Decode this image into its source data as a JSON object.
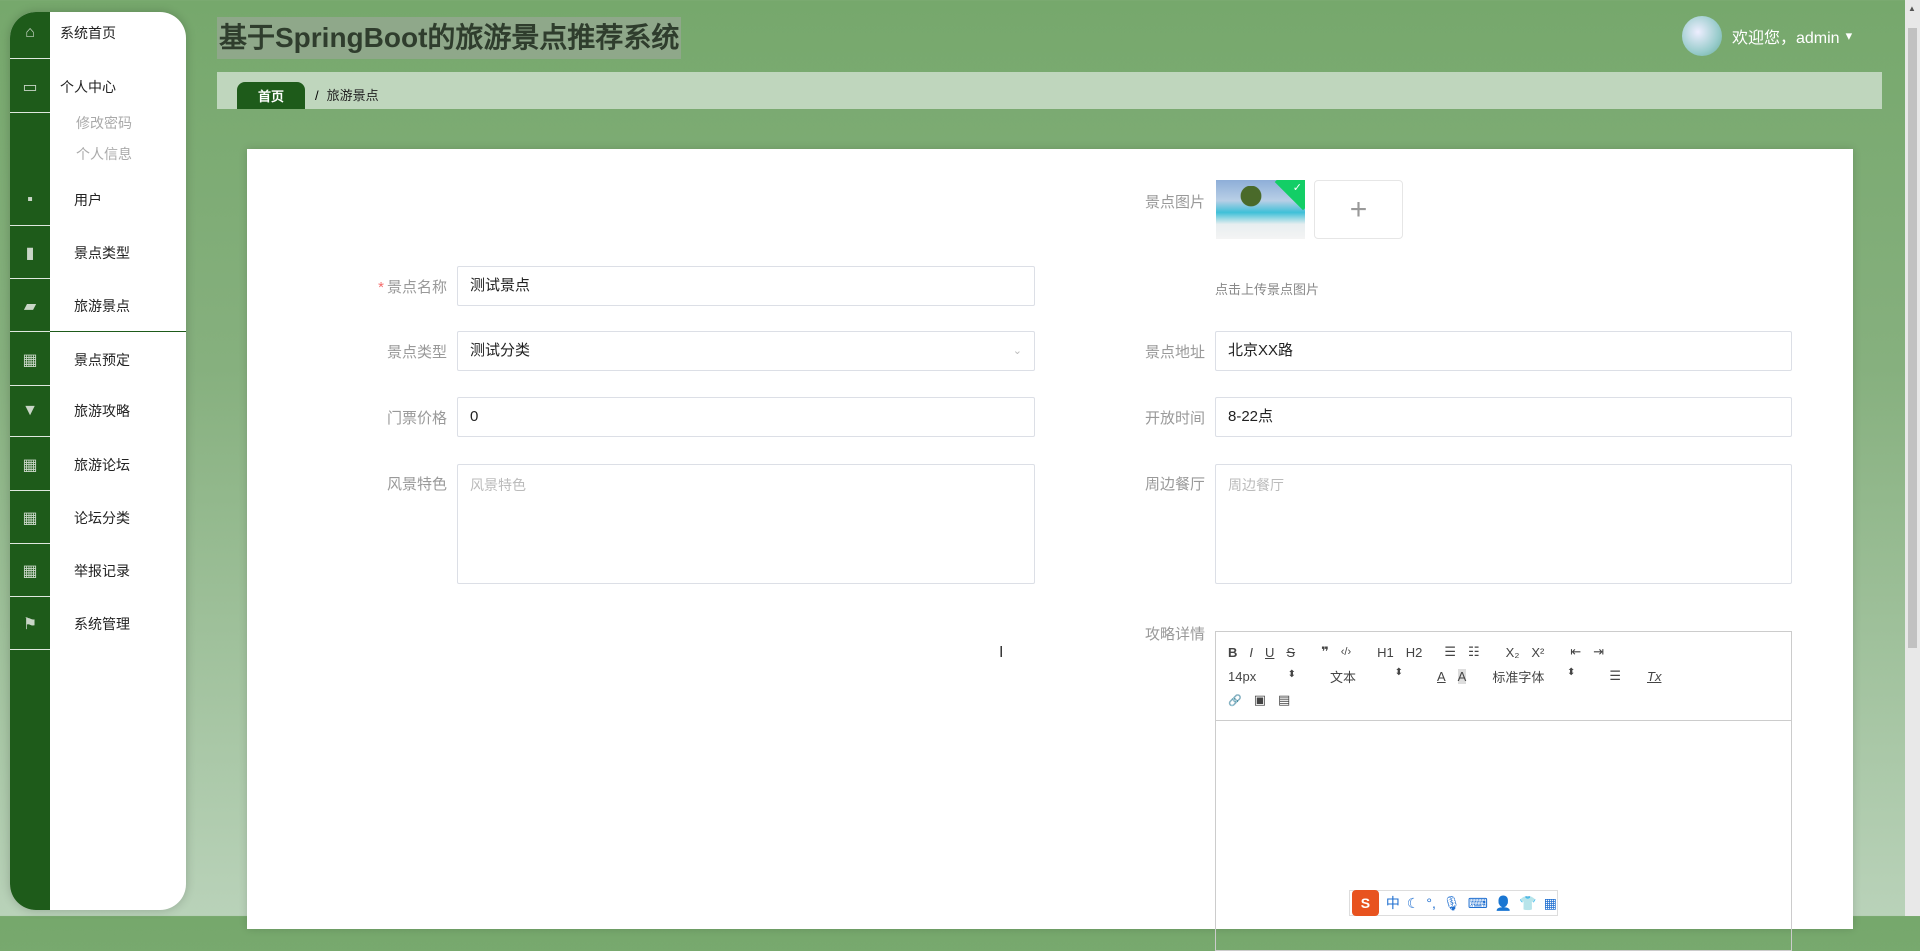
{
  "header": {
    "title": "基于SpringBoot的旅游景点推荐系统",
    "welcome": "欢迎您，admin",
    "caret": "▾"
  },
  "breadcrumb": {
    "home": "首页",
    "separator": "/",
    "current": "旅游景点"
  },
  "sidebar": {
    "items": [
      {
        "label": "系统首页",
        "icon": "home-icon"
      },
      {
        "label": "个人中心",
        "icon": "profile-icon"
      },
      {
        "label": "用户",
        "icon": "briefcase-icon"
      },
      {
        "label": "景点类型",
        "icon": "clipboard-icon"
      },
      {
        "label": "旅游景点",
        "icon": "wallet-icon"
      },
      {
        "label": "景点预定",
        "icon": "grid-icon"
      },
      {
        "label": "旅游攻略",
        "icon": "brush-icon"
      },
      {
        "label": "旅游论坛",
        "icon": "grid-icon"
      },
      {
        "label": "论坛分类",
        "icon": "grid-icon"
      },
      {
        "label": "举报记录",
        "icon": "grid-icon"
      },
      {
        "label": "系统管理",
        "icon": "flag-icon"
      }
    ],
    "sub_items": [
      "修改密码",
      "个人信息"
    ]
  },
  "form": {
    "name": {
      "label": "景点名称",
      "required": "*",
      "value": "测试景点"
    },
    "type": {
      "label": "景点类型",
      "value": "测试分类"
    },
    "price": {
      "label": "门票价格",
      "value": "0"
    },
    "feature": {
      "label": "风景特色",
      "placeholder": "风景特色"
    },
    "image": {
      "label": "景点图片",
      "plus": "+",
      "check": "✓",
      "hint": "点击上传景点图片"
    },
    "address": {
      "label": "景点地址",
      "value": "北京XX路"
    },
    "hours": {
      "label": "开放时间",
      "value": "8-22点"
    },
    "restaurant": {
      "label": "周边餐厅",
      "placeholder": "周边餐厅"
    },
    "detail": {
      "label": "攻略详情"
    }
  },
  "editor": {
    "row1": [
      "B",
      "I",
      "U",
      "S",
      "❞",
      "‹/›",
      "H1",
      "H2",
      "☰",
      "☷",
      "X₂",
      "X²",
      "⇤",
      "⇥"
    ],
    "font_size": "14px",
    "header": "文本",
    "font": "标准字体",
    "color": "A",
    "bg": "A",
    "align": "☰",
    "clean": "Tx",
    "spin": "⬍",
    "row3": [
      "🔗",
      "▣",
      "▤"
    ]
  },
  "ime": {
    "logo": "S",
    "items": [
      "中",
      "☾",
      "°,",
      "🎙",
      "⌨",
      "👤",
      "👕",
      "▦"
    ]
  }
}
